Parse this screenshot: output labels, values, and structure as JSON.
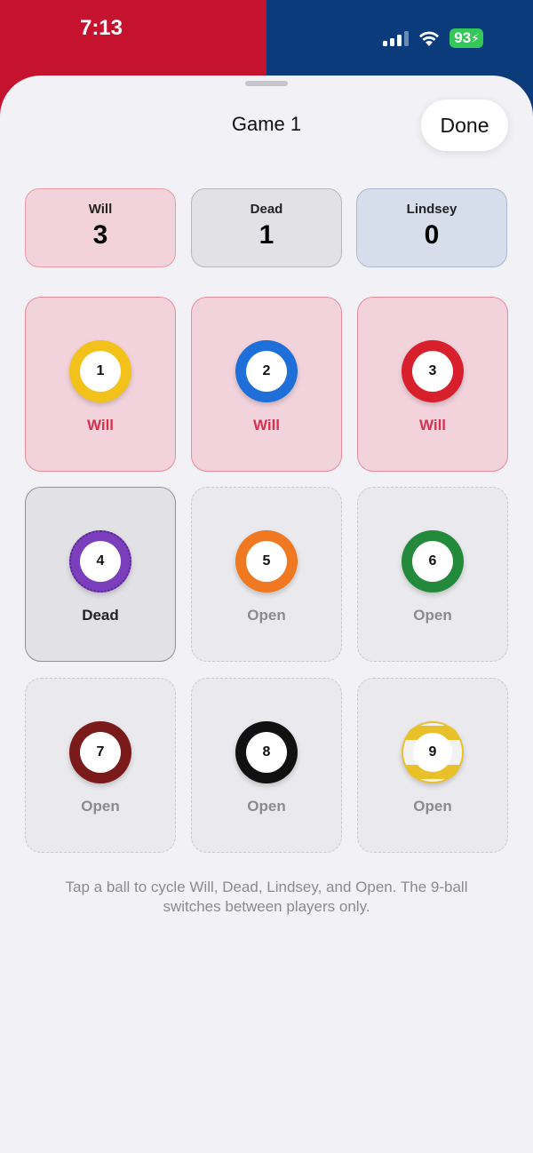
{
  "status_bar": {
    "time": "7:13",
    "battery": "93",
    "icons": [
      "cellular-signal-icon",
      "wifi-icon",
      "battery-charging-icon"
    ]
  },
  "header": {
    "title": "Game 1",
    "done_label": "Done"
  },
  "scores": [
    {
      "name": "Will",
      "value": "3"
    },
    {
      "name": "Dead",
      "value": "1"
    },
    {
      "name": "Lindsey",
      "value": "0"
    }
  ],
  "balls": [
    {
      "number": "1",
      "status": "Will",
      "color": "#f2c21b"
    },
    {
      "number": "2",
      "status": "Will",
      "color": "#1f6fd8"
    },
    {
      "number": "3",
      "status": "Will",
      "color": "#d8202c"
    },
    {
      "number": "4",
      "status": "Dead",
      "color": "#7b3fbe"
    },
    {
      "number": "5",
      "status": "Open",
      "color": "#f07820"
    },
    {
      "number": "6",
      "status": "Open",
      "color": "#238a3c"
    },
    {
      "number": "7",
      "status": "Open",
      "color": "#7a1a1a"
    },
    {
      "number": "8",
      "status": "Open",
      "color": "#111111"
    },
    {
      "number": "9",
      "status": "Open",
      "color": "#e8c12a"
    }
  ],
  "footer_text": "Tap a ball to cycle Will, Dead, Lindsey, and Open. The 9-ball switches between players only.",
  "colors": {
    "will_accent": "#d9304f",
    "will_bg": "#f2d3dc",
    "dead_bg": "#e1e1e6",
    "lindsey_bg": "#d5deea",
    "header_left": "#c4122f",
    "header_right": "#0b3b7a"
  }
}
